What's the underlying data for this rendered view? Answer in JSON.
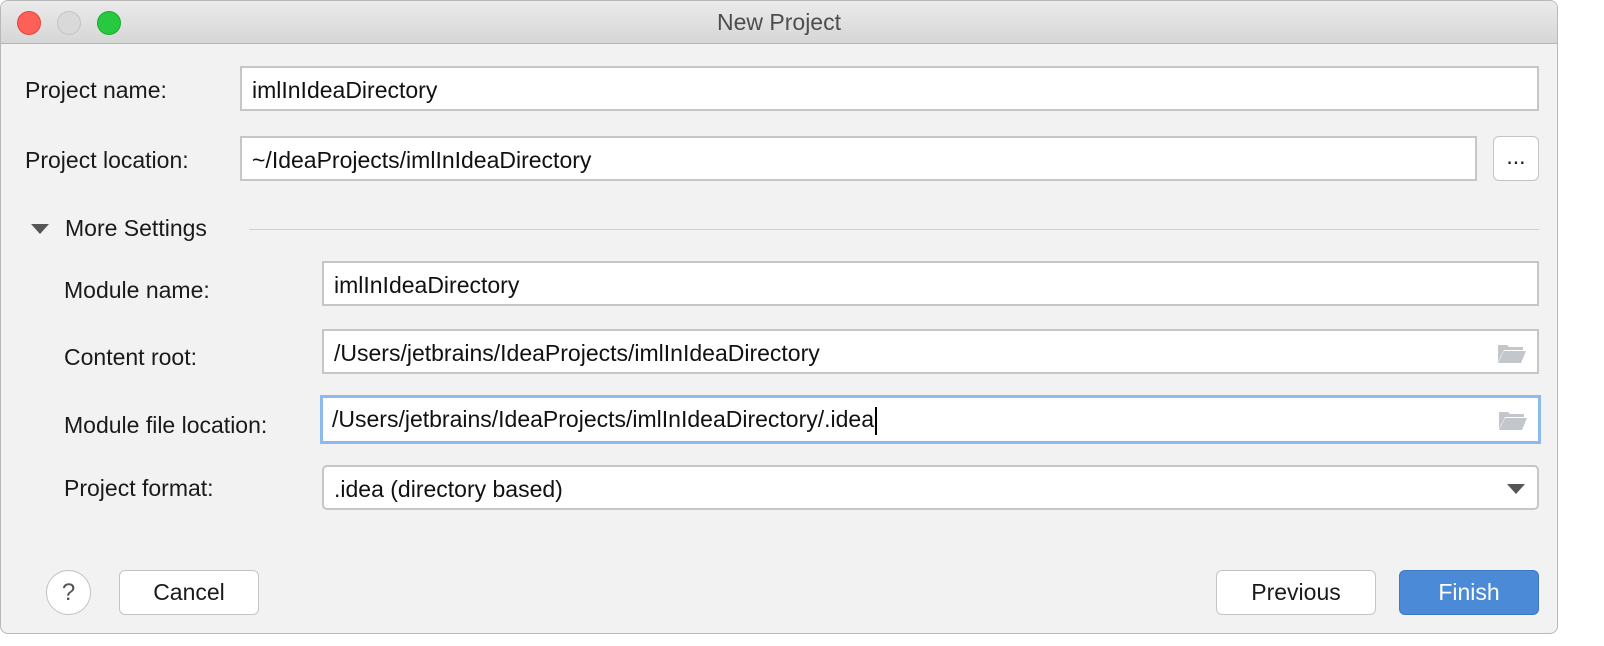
{
  "window": {
    "title": "New Project"
  },
  "form": {
    "project_name_label": "Project name:",
    "project_name": "imlInIdeaDirectory",
    "project_location_label": "Project location:",
    "project_location": "~/IdeaProjects/imlInIdeaDirectory",
    "browse_label": "...",
    "more_settings_label": "More Settings",
    "module_name_label": "Module name:",
    "module_name": "imlInIdeaDirectory",
    "content_root_label": "Content root:",
    "content_root": "/Users/jetbrains/IdeaProjects/imlInIdeaDirectory",
    "module_file_location_label": "Module file location:",
    "module_file_location": "/Users/jetbrains/IdeaProjects/imlInIdeaDirectory/.idea",
    "project_format_label": "Project format:",
    "project_format": ".idea (directory based)"
  },
  "buttons": {
    "help": "?",
    "cancel": "Cancel",
    "previous": "Previous",
    "finish": "Finish"
  },
  "colors": {
    "accent": "#4a8ad6",
    "focus": "#8db9ef"
  }
}
